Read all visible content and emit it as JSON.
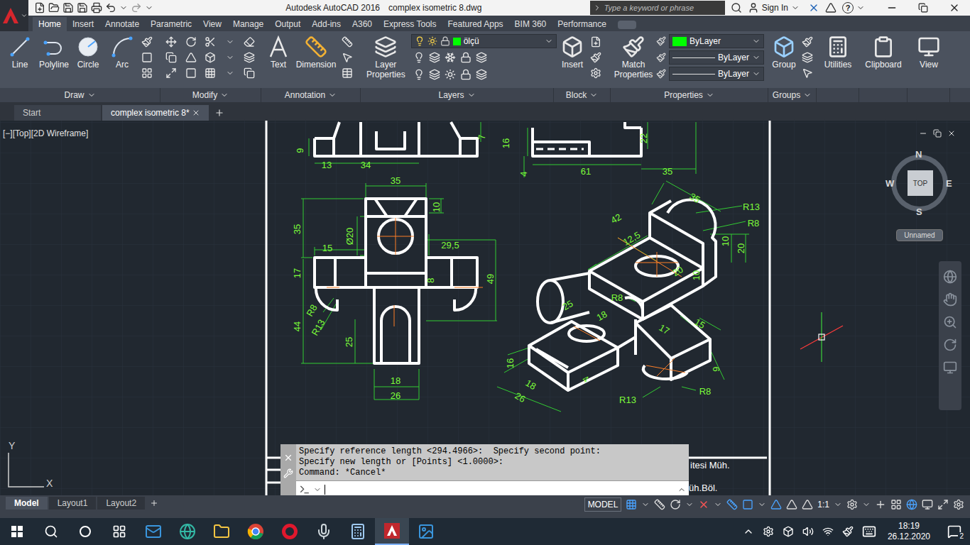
{
  "window": {
    "app_title": "Autodesk AutoCAD 2016",
    "file_title": "complex isometric 8.dwg",
    "search_placeholder": "Type a keyword or phrase",
    "sign_in": "Sign In",
    "help": "?"
  },
  "ribbon_tabs": [
    {
      "label": "Home",
      "selected": true
    },
    {
      "label": "Insert",
      "selected": false
    },
    {
      "label": "Annotate",
      "selected": false
    },
    {
      "label": "Parametric",
      "selected": false
    },
    {
      "label": "View",
      "selected": false
    },
    {
      "label": "Manage",
      "selected": false
    },
    {
      "label": "Output",
      "selected": false
    },
    {
      "label": "Add-ins",
      "selected": false
    },
    {
      "label": "A360",
      "selected": false
    },
    {
      "label": "Express Tools",
      "selected": false
    },
    {
      "label": "Featured Apps",
      "selected": false
    },
    {
      "label": "BIM 360",
      "selected": false
    },
    {
      "label": "Performance",
      "selected": false
    }
  ],
  "ribbon": {
    "draw": {
      "title": "Draw",
      "tools": [
        "Line",
        "Polyline",
        "Circle",
        "Arc"
      ]
    },
    "modify": {
      "title": "Modify"
    },
    "annotation": {
      "title": "Annotation",
      "tools": [
        "Text",
        "Dimension"
      ]
    },
    "layers": {
      "title": "Layers",
      "tool": "Layer Properties",
      "current_layer": "ölçü",
      "layer_color": "#00ff00"
    },
    "block": {
      "title": "Block",
      "tool": "Insert"
    },
    "properties": {
      "title": "Properties",
      "tool": "Match Properties",
      "color": "ByLayer",
      "color_swatch": "#00ff00",
      "linetype": "ByLayer",
      "lineweight": "ByLayer"
    },
    "groups": {
      "title": "Groups",
      "tool": "Group"
    },
    "more_panels": [
      "Utilities",
      "Clipboard",
      "View"
    ]
  },
  "file_tabs": [
    {
      "label": "Start",
      "selected": false,
      "closable": false
    },
    {
      "label": "complex isometric 8*",
      "selected": true,
      "closable": true
    }
  ],
  "viewport": {
    "label": "[−][Top][2D Wireframe]"
  },
  "viewcube": {
    "north": "N",
    "south": "S",
    "east": "E",
    "west": "W",
    "face": "TOP",
    "ucs": "Unnamed"
  },
  "ucs_icon": {
    "x_axis": "X",
    "y_axis": "Y"
  },
  "drawing": {
    "dimensions": [
      "9",
      "13",
      "34",
      "7",
      "16",
      "4",
      "61",
      "35",
      "22",
      "35",
      "10",
      "35",
      "Ø20",
      "15",
      "29,5",
      "17",
      "8",
      "49",
      "R8",
      "R13",
      "44",
      "25",
      "18",
      "26",
      "35",
      "R13",
      "42",
      "R8",
      "12,5",
      "10",
      "20",
      "20",
      "10",
      "R8",
      "25",
      "18",
      "17",
      "15",
      "16",
      "18",
      "26",
      "9",
      "R13",
      "R8",
      "4"
    ],
    "title_block": [
      "itesi Müh.",
      "üh.Böl."
    ]
  },
  "command_line": {
    "history": [
      "Specify reference length <294.4966>:  Specify second point:",
      "Specify new length or [Points] <1.0000>:",
      "Command: *Cancel*"
    ]
  },
  "layout_tabs": [
    {
      "label": "Model",
      "selected": true
    },
    {
      "label": "Layout1",
      "selected": false
    },
    {
      "label": "Layout2",
      "selected": false
    }
  ],
  "status_bar": {
    "space": "MODEL",
    "scale": "1:1"
  },
  "taskbar": {
    "time": "18:19",
    "date": "26.12.2020",
    "notifications": "2"
  }
}
